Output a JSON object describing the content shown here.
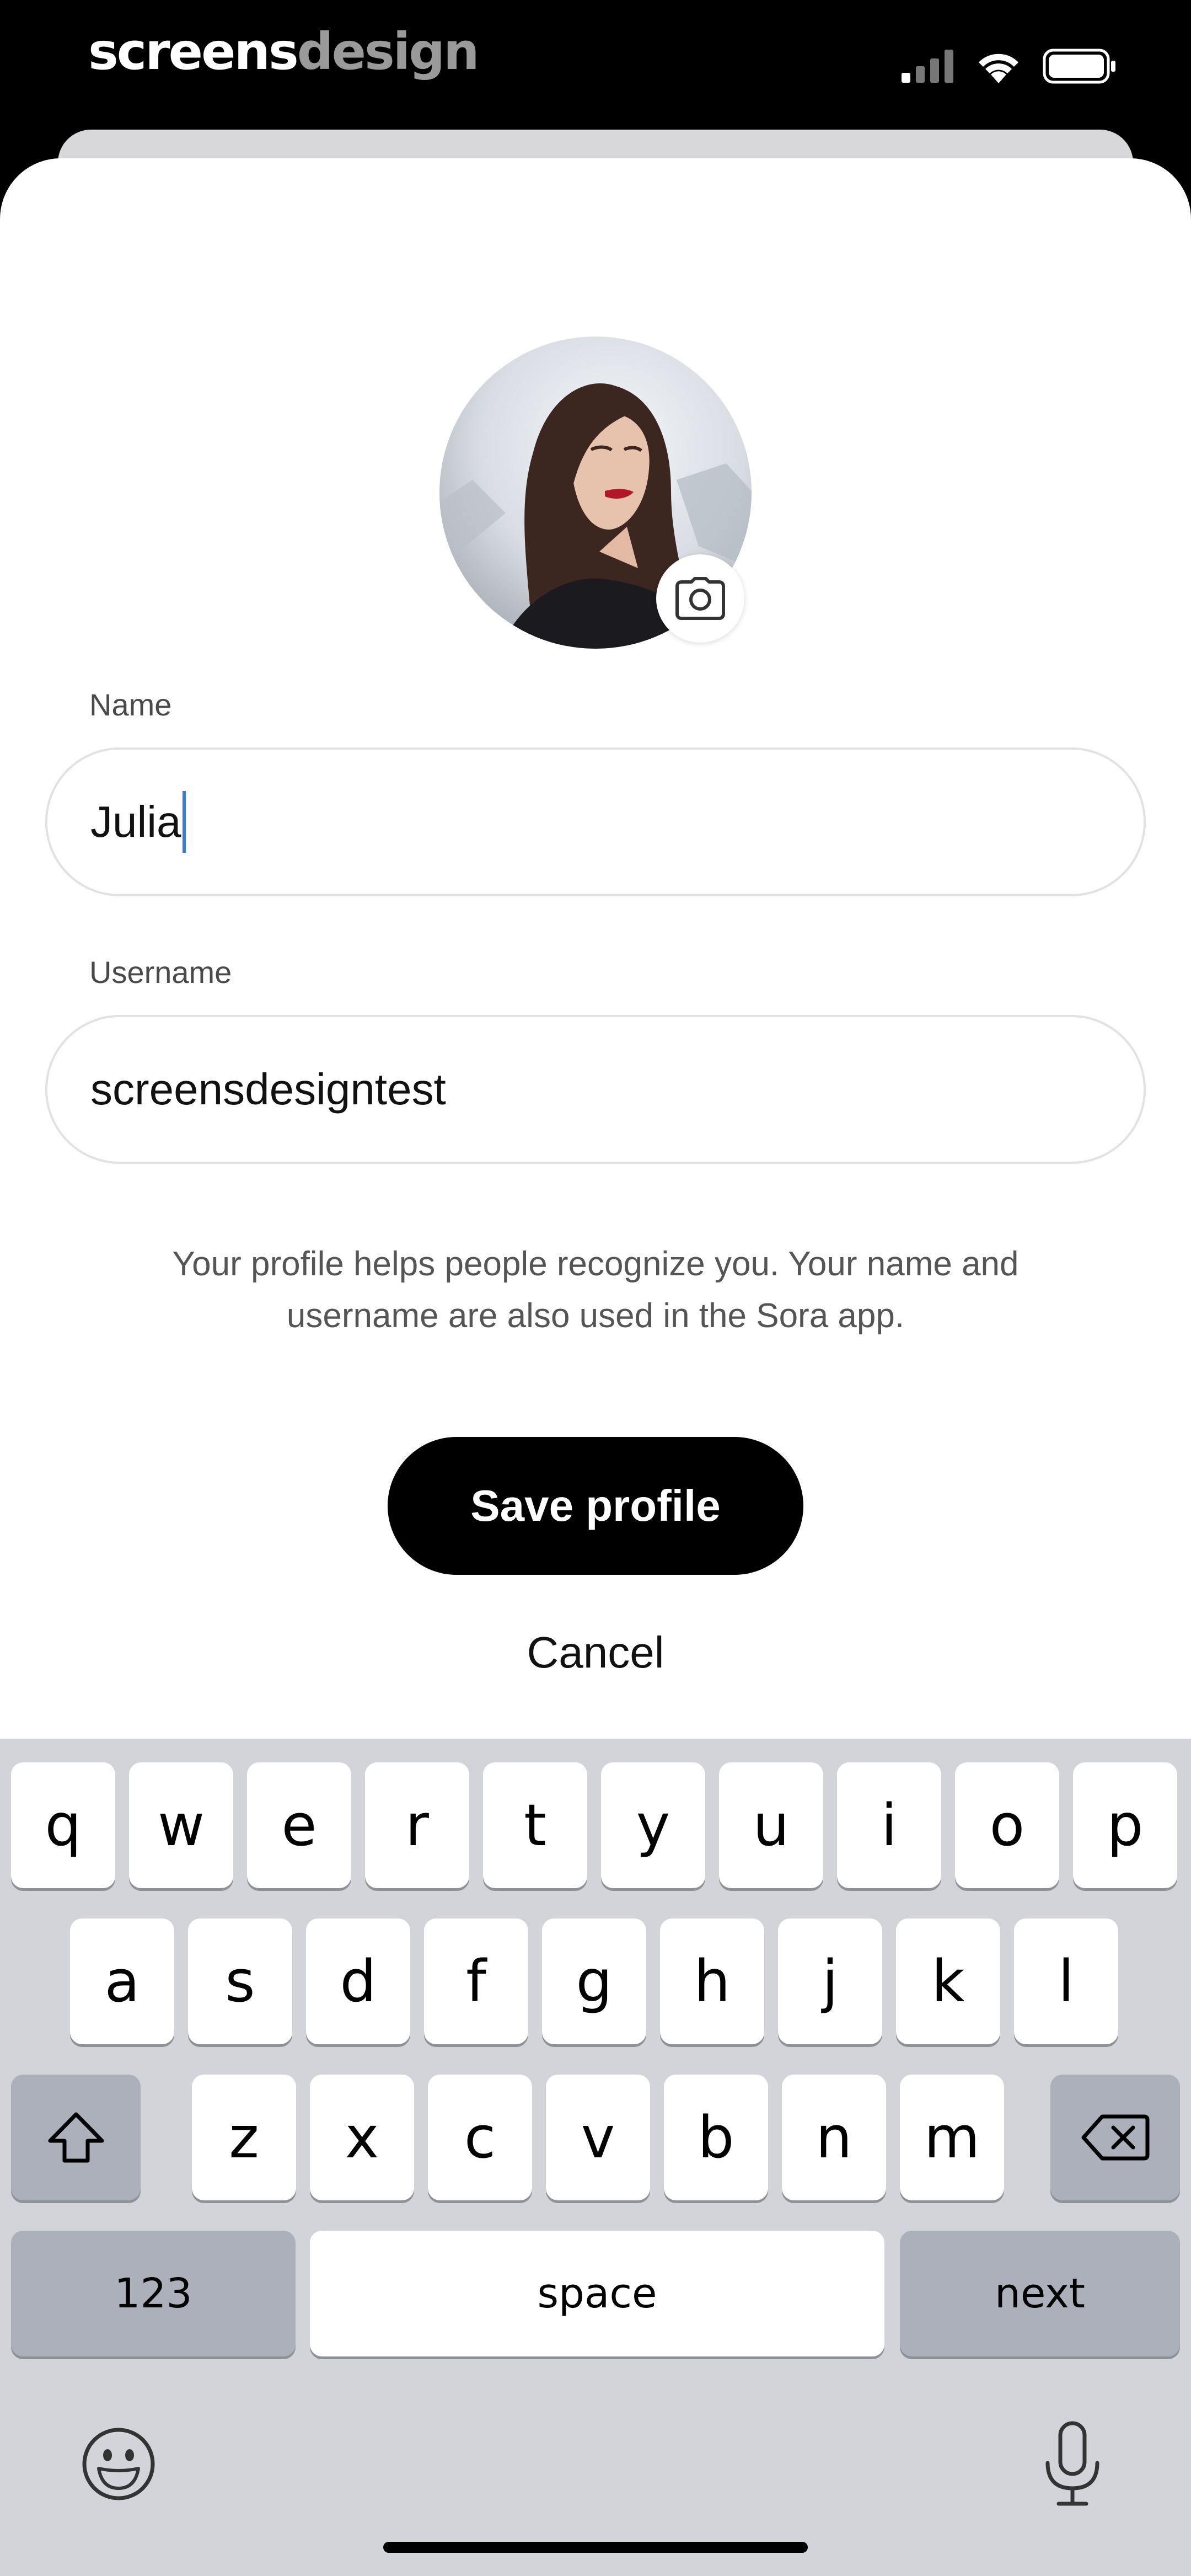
{
  "status_bar": {
    "brand_part1": "screens",
    "brand_part2": "design",
    "icons": [
      "cellular-signal-icon",
      "wifi-icon",
      "battery-icon"
    ]
  },
  "profile": {
    "avatar": "profile-photo",
    "camera_icon": "camera-icon"
  },
  "form": {
    "name_label": "Name",
    "name_value": "Julia",
    "username_label": "Username",
    "username_value": "screensdesigntest",
    "helper_text": "Your profile helps people recognize you. Your name and username are also used in the Sora app."
  },
  "actions": {
    "save_label": "Save profile",
    "cancel_label": "Cancel"
  },
  "keyboard": {
    "row1": [
      "q",
      "w",
      "e",
      "r",
      "t",
      "y",
      "u",
      "i",
      "o",
      "p"
    ],
    "row2": [
      "a",
      "s",
      "d",
      "f",
      "g",
      "h",
      "j",
      "k",
      "l"
    ],
    "row3": [
      "z",
      "x",
      "c",
      "v",
      "b",
      "n",
      "m"
    ],
    "numbers_label": "123",
    "space_label": "space",
    "next_label": "next",
    "shift_icon": "shift-icon",
    "delete_icon": "delete-icon",
    "emoji_icon": "emoji-icon",
    "mic_icon": "microphone-icon"
  },
  "colors": {
    "primary_button": "#000000",
    "caret": "#3a7bd5",
    "keyboard_bg": "#d2d4da",
    "special_key": "#abb0bb"
  }
}
